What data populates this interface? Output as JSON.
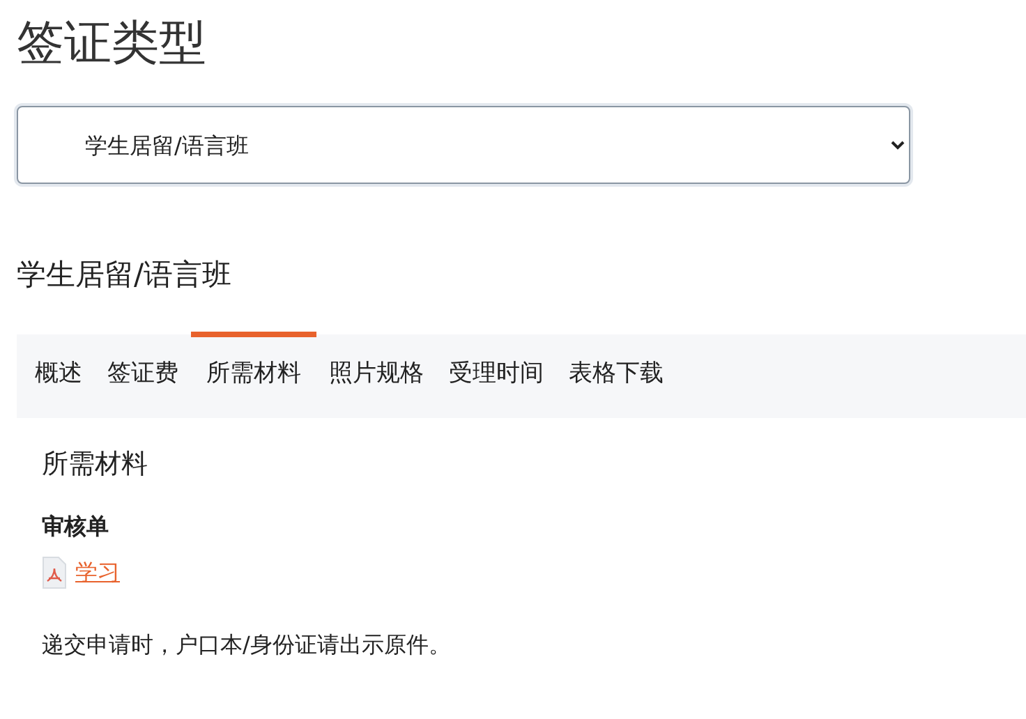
{
  "title": "签证类型",
  "visa_select": {
    "value": "学生居留/语言班"
  },
  "heading": "学生居留/语言班",
  "tabs": [
    {
      "label": "概述",
      "selected": false
    },
    {
      "label": "签证费",
      "selected": false
    },
    {
      "label": "所需材料",
      "selected": true
    },
    {
      "label": "照片规格",
      "selected": false
    },
    {
      "label": "受理时间",
      "selected": false
    },
    {
      "label": "表格下载",
      "selected": false
    }
  ],
  "content": {
    "title": "所需材料",
    "section": "审核单",
    "file_link": "学习",
    "note": "递交申请时，户口本/身份证请出示原件。"
  }
}
